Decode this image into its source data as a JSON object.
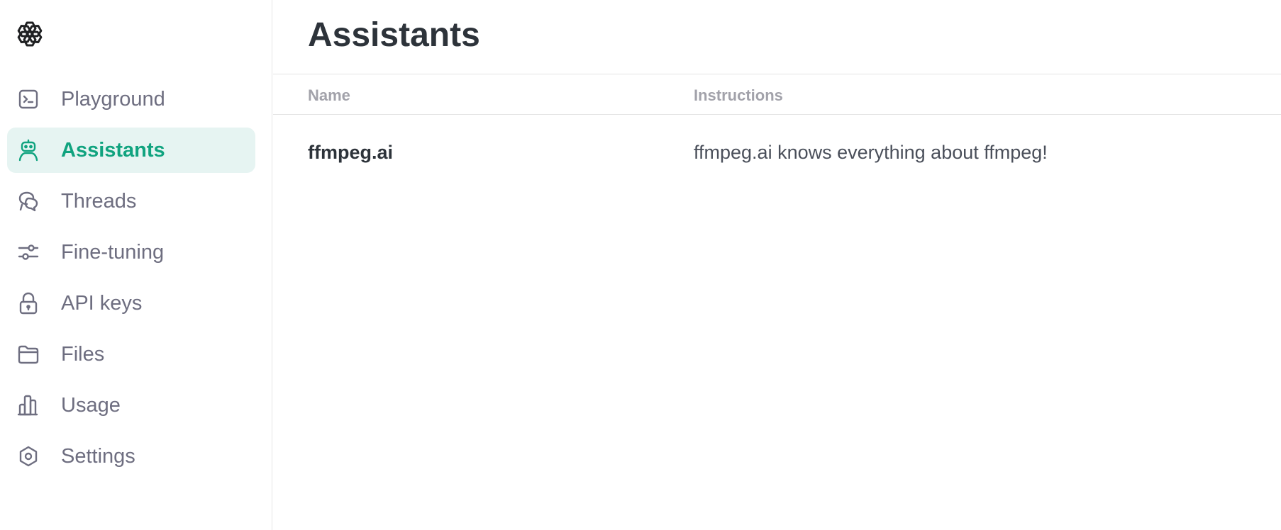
{
  "colors": {
    "accent": "#10a37f",
    "active_bg": "#e6f4f2",
    "nav_text": "#6e6e80",
    "heading_text": "#2d333a",
    "column_header_text": "#a2a2aa"
  },
  "sidebar": {
    "logo_icon": "openai-logo-icon",
    "items": [
      {
        "label": "Playground",
        "icon": "terminal-icon",
        "active": false
      },
      {
        "label": "Assistants",
        "icon": "robot-icon",
        "active": true
      },
      {
        "label": "Threads",
        "icon": "chat-bubbles-icon",
        "active": false
      },
      {
        "label": "Fine-tuning",
        "icon": "sliders-icon",
        "active": false
      },
      {
        "label": "API keys",
        "icon": "lock-icon",
        "active": false
      },
      {
        "label": "Files",
        "icon": "folder-icon",
        "active": false
      },
      {
        "label": "Usage",
        "icon": "bar-chart-icon",
        "active": false
      },
      {
        "label": "Settings",
        "icon": "gear-icon",
        "active": false
      }
    ]
  },
  "main": {
    "title": "Assistants",
    "table": {
      "columns": [
        "Name",
        "Instructions"
      ],
      "rows": [
        {
          "name": "ffmpeg.ai",
          "instructions": "ffmpeg.ai knows everything about ffmpeg!"
        }
      ]
    }
  }
}
